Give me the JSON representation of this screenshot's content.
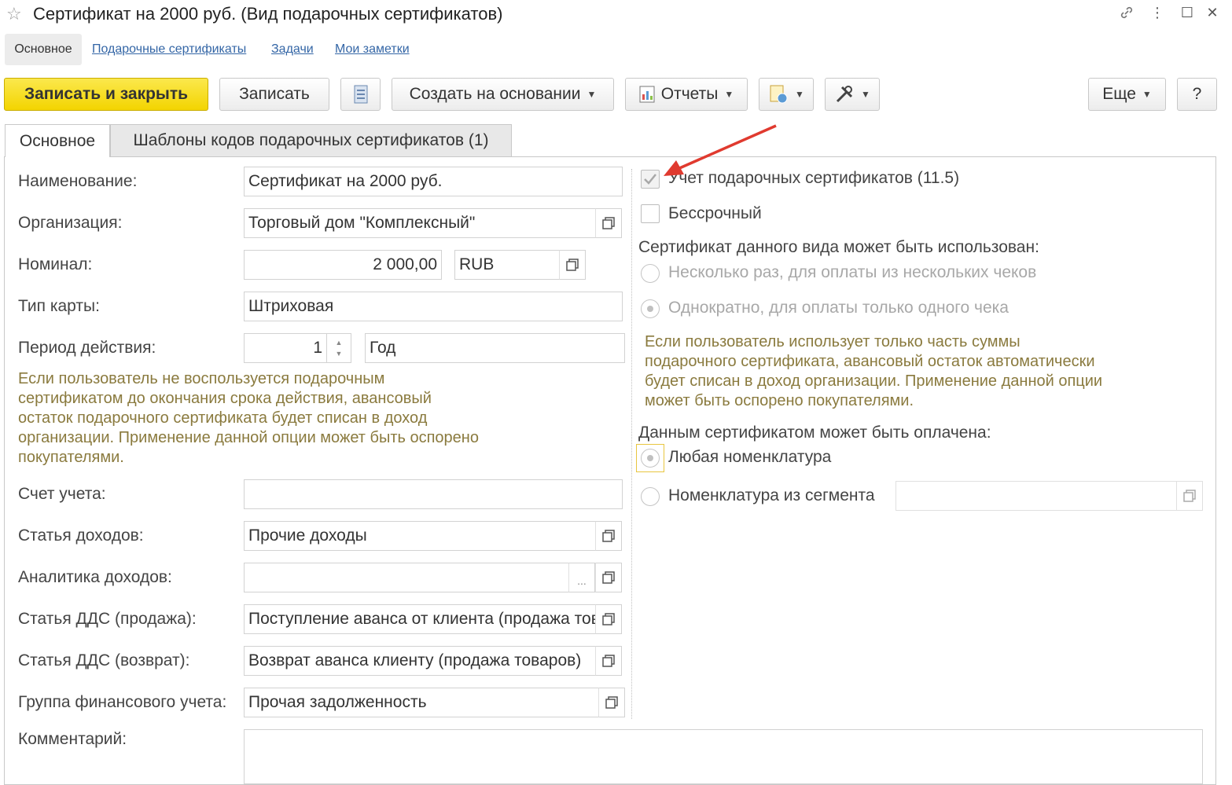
{
  "window": {
    "title": "Сертификат на 2000 руб. (Вид подарочных сертификатов)"
  },
  "nav": {
    "main": "Основное",
    "links": [
      "Подарочные сертификаты",
      "Задачи",
      "Мои заметки"
    ]
  },
  "toolbar": {
    "save_close": "Записать и закрыть",
    "save": "Записать",
    "create_based": "Создать на основании",
    "reports": "Отчеты",
    "more": "Еще",
    "help": "?"
  },
  "tabs": [
    "Основное",
    "Шаблоны кодов подарочных сертификатов (1)"
  ],
  "form": {
    "name": {
      "label": "Наименование:",
      "value": "Сертификат на 2000 руб."
    },
    "organization": {
      "label": "Организация:",
      "value": "Торговый дом \"Комплексный\""
    },
    "nominal": {
      "label": "Номинал:",
      "value": "2 000,00",
      "currency": "RUB"
    },
    "card_type": {
      "label": "Тип карты:",
      "value": "Штриховая"
    },
    "period": {
      "label": "Период действия:",
      "value": "1",
      "unit": "Год"
    },
    "period_hint": [
      "Если пользователь не воспользуется подарочным",
      "сертификатом до окончания срока действия, авансовый",
      "остаток подарочного сертификата будет списан в доход",
      "организации. Применение данной опции может быть оспорено",
      "покупателями."
    ],
    "account": {
      "label": "Счет учета:",
      "value": ""
    },
    "income_item": {
      "label": "Статья доходов:",
      "value": "Прочие доходы"
    },
    "income_analytics": {
      "label": "Аналитика доходов:",
      "value": "",
      "ellipsis": "..."
    },
    "cashflow_sale": {
      "label": "Статья ДДС (продажа):",
      "value": "Поступление аванса от клиента (продажа товаров)"
    },
    "cashflow_return": {
      "label": "Статья ДДС (возврат):",
      "value": "Возврат аванса клиенту (продажа товаров)"
    },
    "fin_group": {
      "label": "Группа финансового учета:",
      "value": "Прочая задолженность"
    },
    "comment": {
      "label": "Комментарий:",
      "value": ""
    }
  },
  "right": {
    "accounting_checkbox": {
      "label": "Учет подарочных сертификатов (11.5)",
      "checked": true
    },
    "perpetual_checkbox": {
      "label": "Бессрочный",
      "checked": false
    },
    "usage_title": "Сертификат данного вида может быть использован:",
    "usage_multiple": "Несколько раз, для оплаты из нескольких чеков",
    "usage_once": "Однократно, для оплаты только одного чека",
    "usage_hint": [
      "Если пользователь использует только часть суммы",
      "подарочного сертификата, авансовый остаток автоматически",
      "будет списан в доход организации. Применение данной опции",
      "может быть оспорено покупателями."
    ],
    "pay_title": "Данным сертификатом может быть оплачена:",
    "pay_any": "Любая номенклатура",
    "pay_segment": "Номенклатура из сегмента",
    "segment_value": ""
  },
  "colors": {
    "primary_button": "#f3d400",
    "hint_text": "#8a7a3e",
    "link": "#3466a6",
    "annotation_arrow": "#e03a2f"
  }
}
